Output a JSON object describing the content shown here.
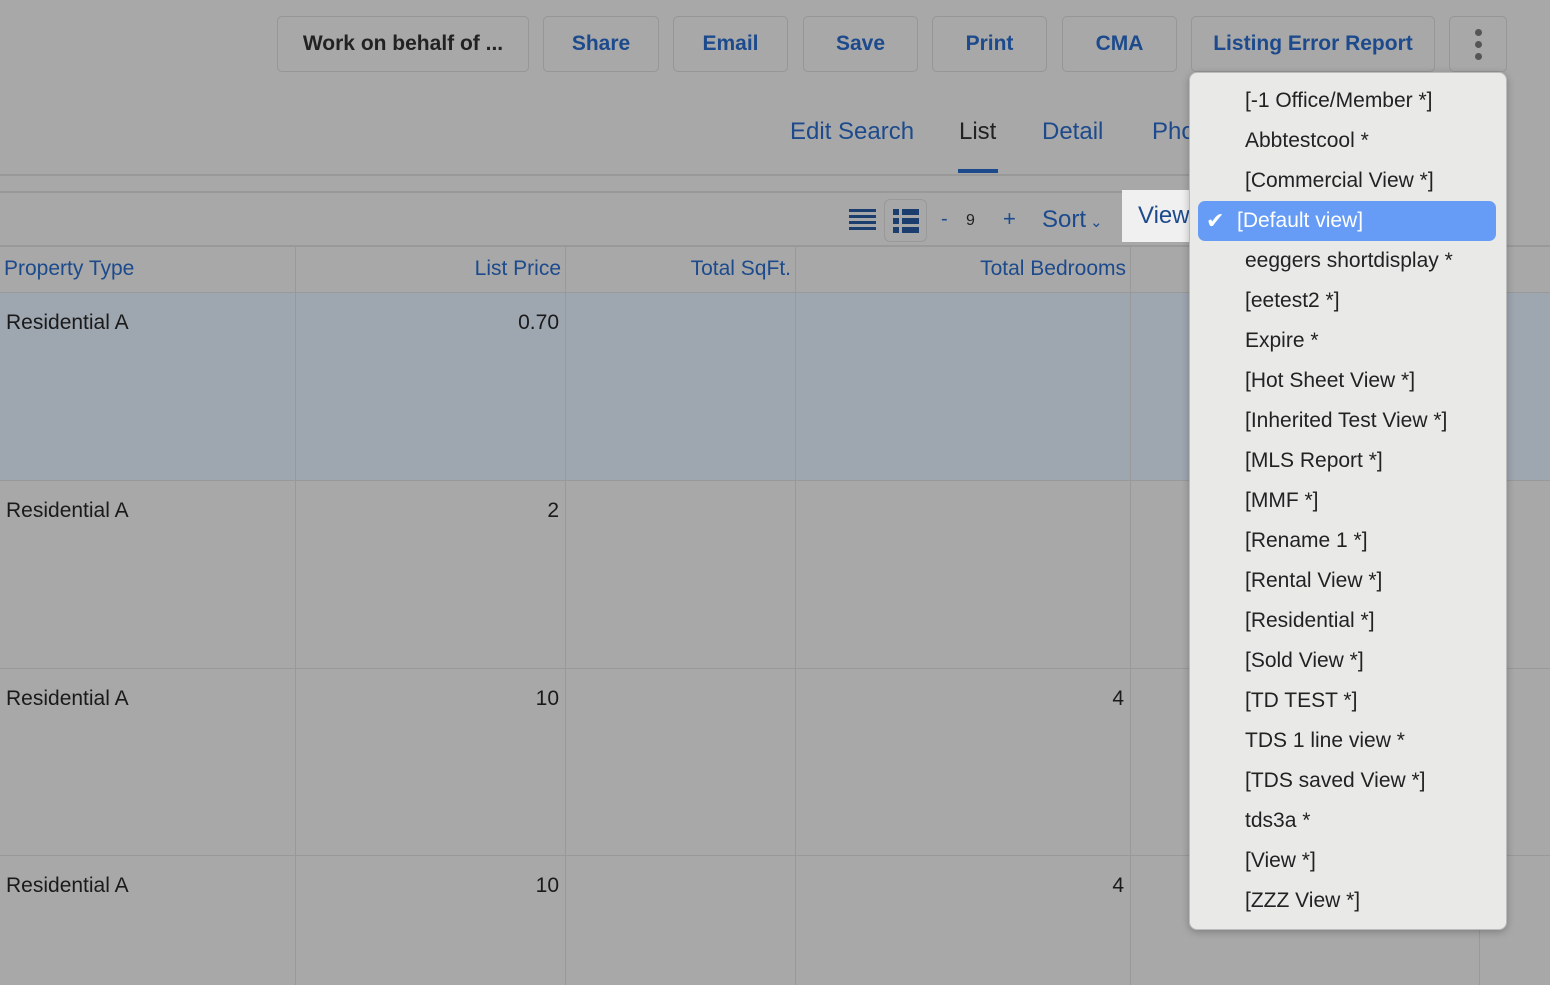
{
  "toolbar": {
    "work_on_behalf": "Work on behalf of ...",
    "share": "Share",
    "email": "Email",
    "save": "Save",
    "print": "Print",
    "cma": "CMA",
    "listing_error_report": "Listing Error Report",
    "more_icon": "vertical-ellipsis"
  },
  "tabs": [
    {
      "label": "Edit Search"
    },
    {
      "label": "List",
      "active": true
    },
    {
      "label": "Detail"
    },
    {
      "label": "Pho"
    }
  ],
  "list_controls": {
    "minus": "-",
    "count": "9",
    "plus": "+",
    "sort": "Sort",
    "view": "View"
  },
  "table": {
    "headers": [
      "Property Type",
      "List Price",
      "Total SqFt.",
      "Total Bedrooms"
    ],
    "rows": [
      {
        "cells": [
          "Residential A",
          "0.70",
          "",
          ""
        ],
        "selected": true
      },
      {
        "cells": [
          "Residential A",
          "2",
          "",
          ""
        ]
      },
      {
        "cells": [
          "Residential A",
          "10",
          "",
          "4"
        ]
      },
      {
        "cells": [
          "Residential A",
          "10",
          "",
          "4"
        ]
      }
    ]
  },
  "view_dropdown": {
    "selected": "[Default view]",
    "options": [
      "[-1 Office/Member *]",
      "Abbtestcool *",
      "[Commercial View *]",
      "[Default view]",
      "eeggers shortdisplay *",
      "[eetest2 *]",
      "Expire *",
      "[Hot Sheet View *]",
      "[Inherited Test View *]",
      "[MLS Report *]",
      "[MMF *]",
      "[Rename 1 *]",
      "[Rental View *]",
      "[Residential *]",
      "[Sold View *]",
      "[TD TEST *]",
      "TDS 1 line view *",
      "[TDS saved View *]",
      "tds3a *",
      "[View *]",
      "[ZZZ View *]"
    ]
  },
  "colors": {
    "accent": "#1c4a8c",
    "selected_option": "#669cf5",
    "selected_row": "#9ea6b0"
  }
}
